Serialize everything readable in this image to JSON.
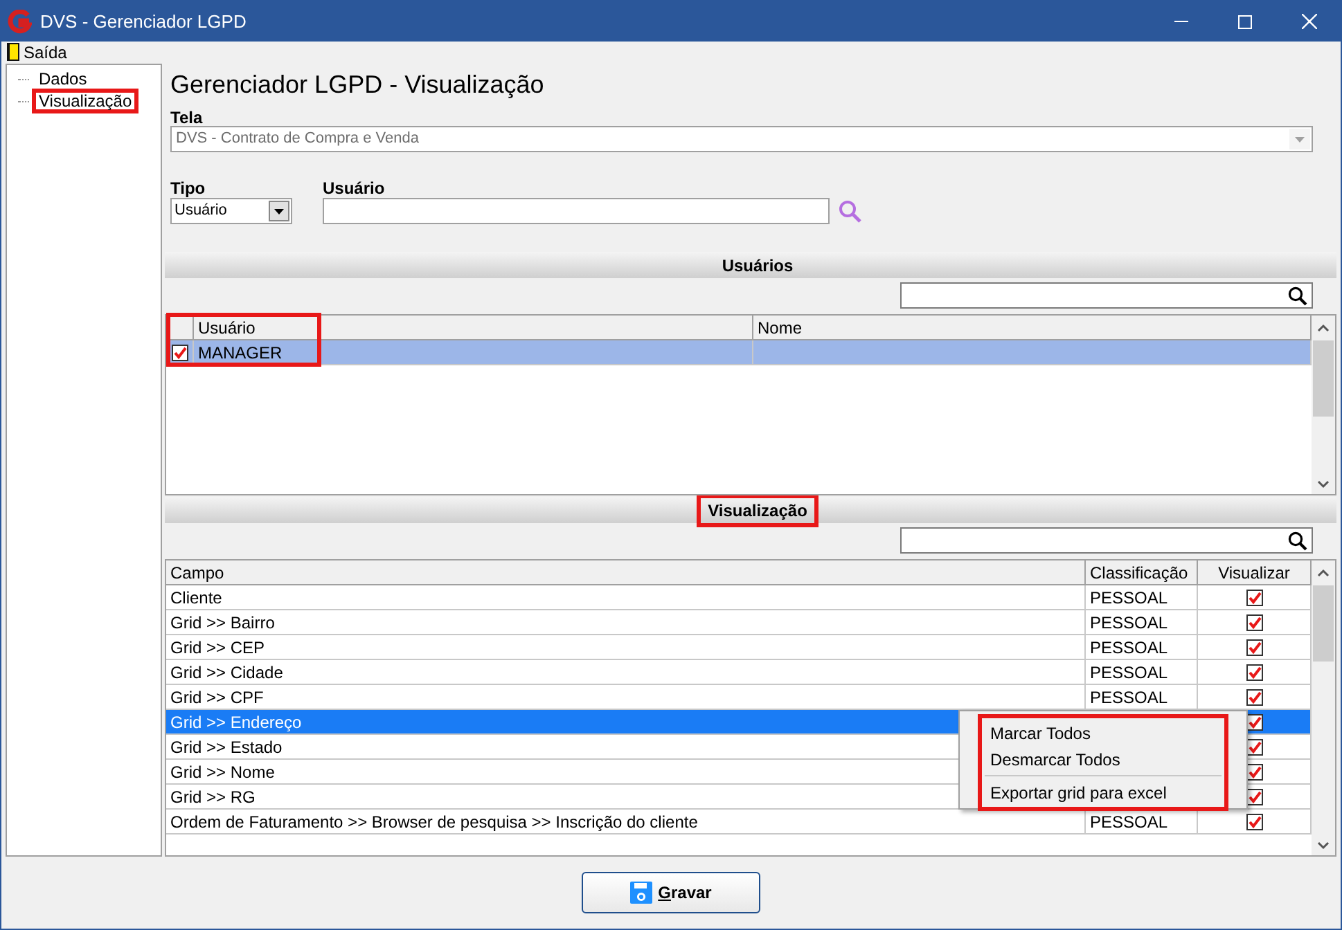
{
  "window": {
    "title": "DVS - Gerenciador LGPD"
  },
  "menu": [
    {
      "label": "Saída"
    }
  ],
  "tree": [
    {
      "label": "Dados",
      "highlighted": false
    },
    {
      "label": "Visualização",
      "highlighted": true
    }
  ],
  "heading": "Gerenciador LGPD - Visualização",
  "tela": {
    "label": "Tela",
    "value": "DVS - Contrato de Compra e Venda",
    "disabled": true
  },
  "tipo": {
    "label": "Tipo",
    "value": "Usuário"
  },
  "usuario": {
    "label": "Usuário"
  },
  "usuarios": {
    "title": "Usuários",
    "highlighted": false,
    "grid_highlighted": true,
    "columns": [
      "Usuário",
      "Nome"
    ],
    "rows": [
      {
        "checked": true,
        "usuario": "MANAGER",
        "selected": true
      }
    ]
  },
  "visualizacao": {
    "title": "Visualização",
    "highlighted": true,
    "columns": [
      "Campo",
      "Classificação",
      "Visualizar"
    ],
    "rows": [
      {
        "campo": "Cliente",
        "classificacao": "PESSOAL",
        "visualizar": true,
        "selected": false
      },
      {
        "campo": "Grid >> Bairro",
        "classificacao": "PESSOAL",
        "visualizar": true,
        "selected": false
      },
      {
        "campo": "Grid >> CEP",
        "classificacao": "PESSOAL",
        "visualizar": true,
        "selected": false
      },
      {
        "campo": "Grid >> Cidade",
        "classificacao": "PESSOAL",
        "visualizar": true,
        "selected": false
      },
      {
        "campo": "Grid >> CPF",
        "classificacao": "PESSOAL",
        "visualizar": true,
        "selected": false
      },
      {
        "campo": "Grid >> Endereço",
        "visualizar": true,
        "selected": true
      },
      {
        "campo": "Grid >> Estado",
        "visualizar": true,
        "selected": false
      },
      {
        "campo": "Grid >> Nome",
        "visualizar": true,
        "selected": false
      },
      {
        "campo": "Grid >> RG",
        "visualizar": true,
        "selected": false
      },
      {
        "campo": "Ordem de Faturamento >> Browser de pesquisa >> Inscrição do cliente",
        "classificacao": "PESSOAL",
        "visualizar": true,
        "selected": false
      }
    ]
  },
  "context_menu": {
    "highlighted": true,
    "items": [
      {
        "kind": "item",
        "label": "Marcar Todos"
      },
      {
        "kind": "item",
        "label": "Desmarcar Todos"
      },
      {
        "kind": "separator"
      },
      {
        "kind": "item",
        "label": "Exportar grid para excel"
      }
    ]
  },
  "buttons": [
    {
      "label": "Gravar"
    }
  ]
}
